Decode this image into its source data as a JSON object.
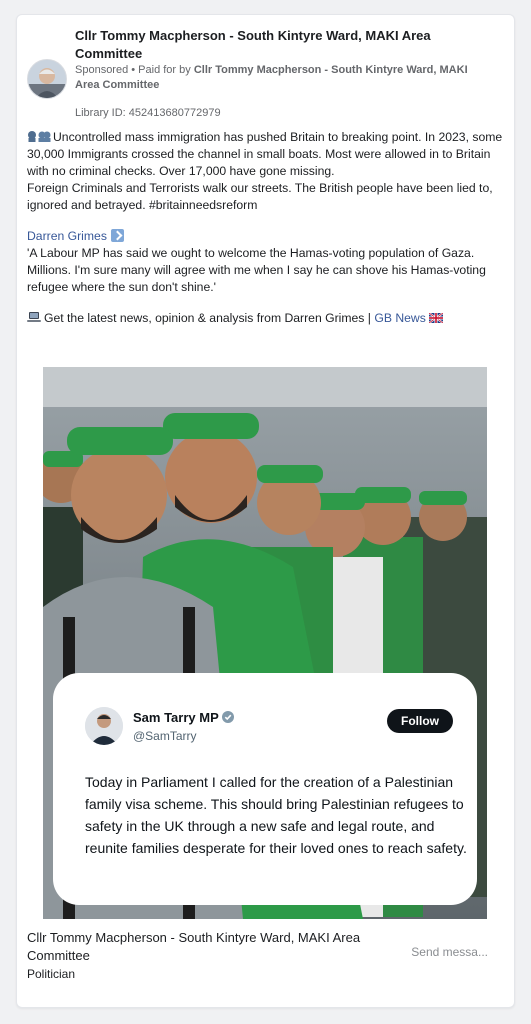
{
  "ad": {
    "page_name": "Cllr Tommy Macpherson - South Kintyre Ward, MAKI Area Committee",
    "sponsored_label": "Sponsored",
    "paid_for_prefix": " • Paid for by ",
    "paid_for_entity": "Cllr Tommy Macpherson - South Kintyre Ward, MAKI Area Committee",
    "library_id": "Library ID: 452413680772979"
  },
  "body": {
    "paragraph1_line1": "Uncontrolled mass immigration has pushed Britain to breaking point. In 2023, some 30,000 Immigrants crossed the channel in small boats. Most were allowed in to Britain with no criminal checks. Over 17,000 have gone missing.",
    "paragraph1_line2": "Foreign Criminals and Terrorists walk our streets. The British people have been lied to, ignored and betrayed. #britainneedsreform",
    "author_name": "Darren Grimes",
    "quote": "'A Labour MP has said we ought to welcome the Hamas-voting population of Gaza. Millions. I'm sure many will agree with me when I say he can shove his Hamas-voting refugee where the sun don't shine.'",
    "cta_text": "Get the latest news, opinion & analysis from Darren Grimes | ",
    "cta_link": "GB News"
  },
  "tweet": {
    "name": "Sam Tarry MP",
    "handle": "@SamTarry",
    "follow_label": "Follow",
    "text": "Today in Parliament I called for the creation of a Palestinian family visa scheme. This should bring Palestinian refugees to safety in the UK through a new safe and legal route, and reunite families desperate for their loved ones to reach safety."
  },
  "footer": {
    "page_name": "Cllr Tommy Macpherson - South Kintyre Ward, MAKI Area Committee",
    "category": "Politician",
    "send_message": "Send messa..."
  },
  "icons": {
    "speaking": "speaking-head-icon",
    "laptop": "laptop-icon",
    "flag": "uk-flag-icon",
    "verified": "verified-badge-icon"
  },
  "colors": {
    "link": "#385898",
    "follow_button": "#0f1419",
    "headband_green": "#2e9a49"
  }
}
